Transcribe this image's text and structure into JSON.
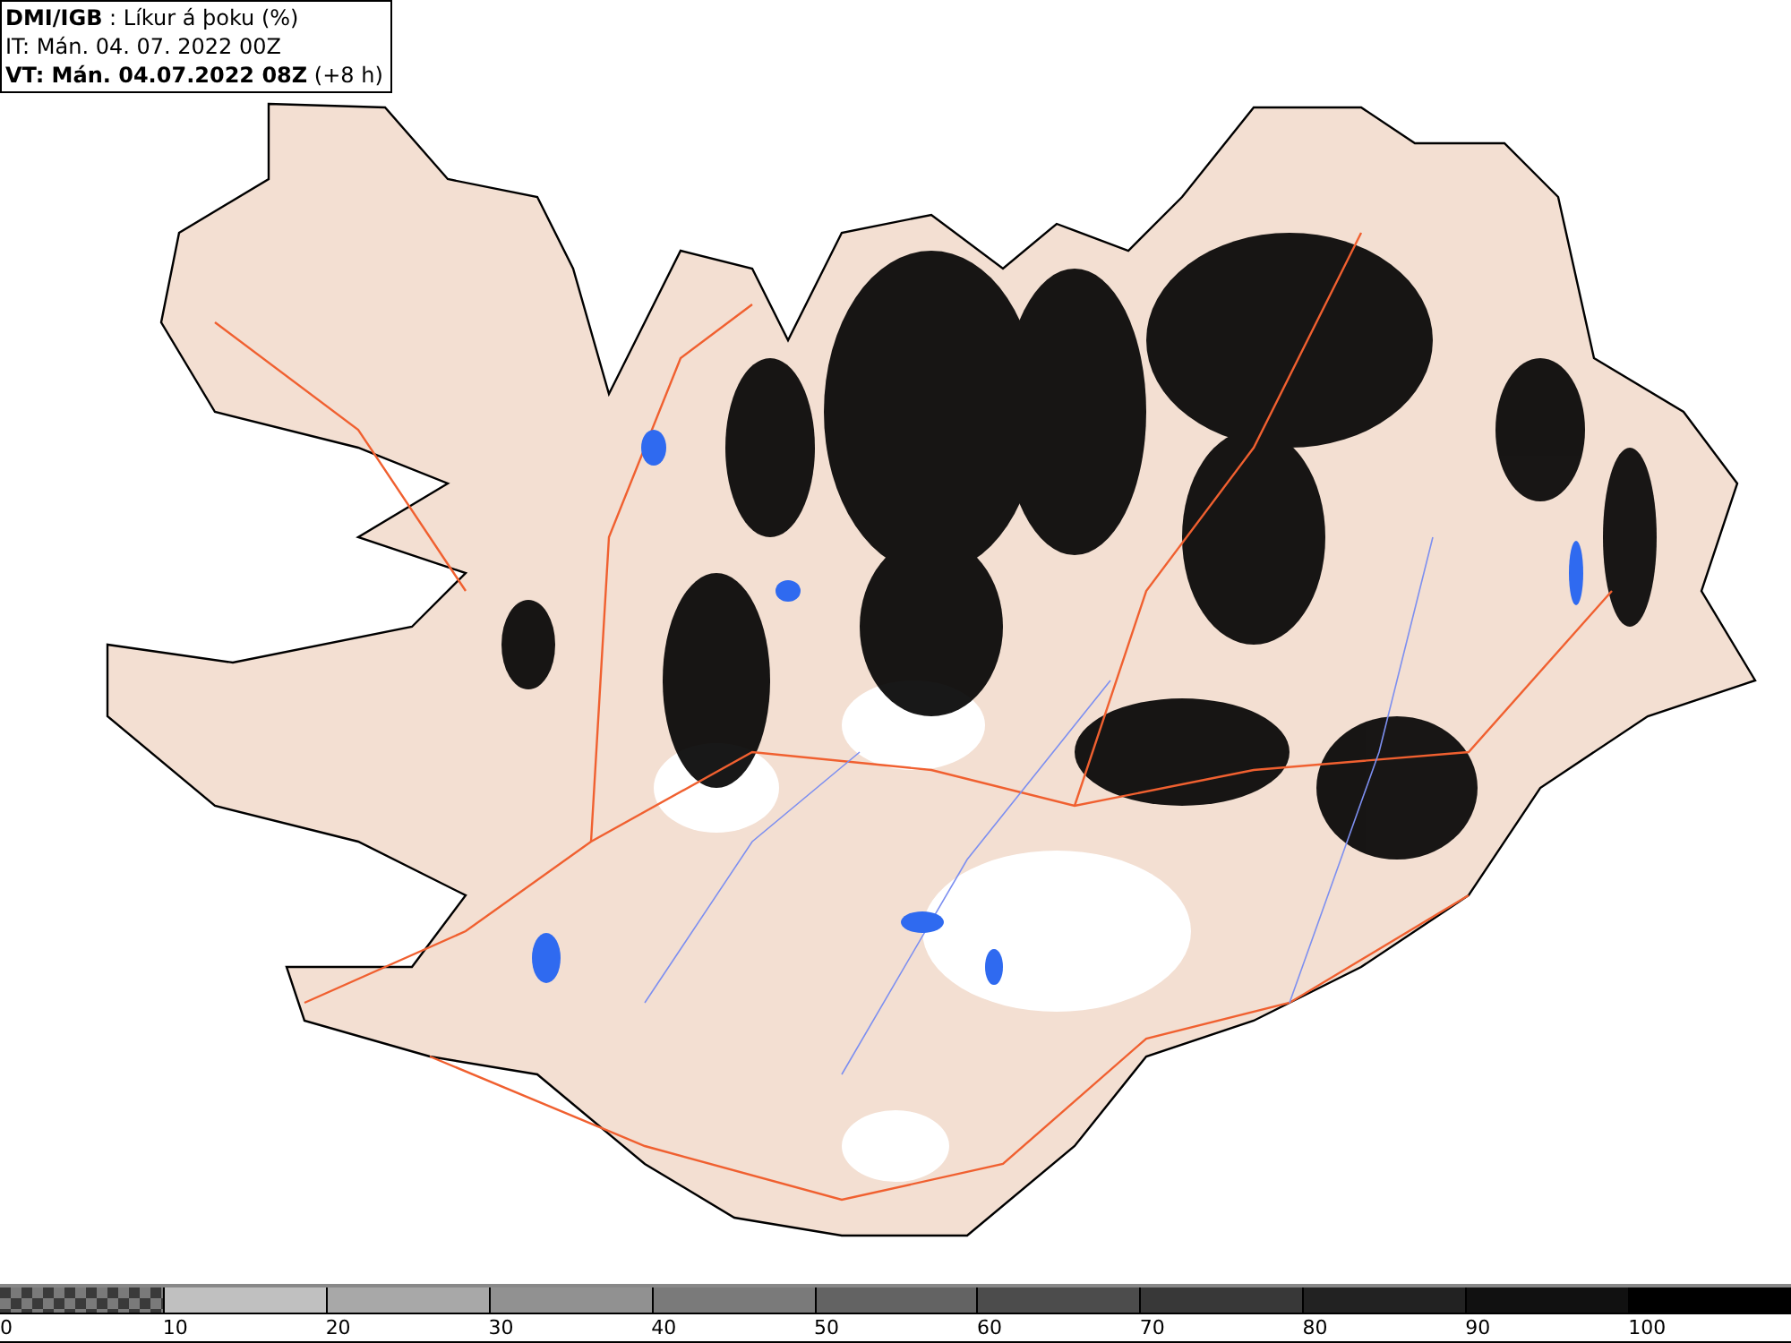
{
  "title_box": {
    "lines": [
      "**DMI/IGB** : Líkur á þoku (%)",
      "IT: Mán. 04. 07. 2022 00Z",
      "**VT: Mán. 04.07.2022 08Z** (+8 h)"
    ]
  },
  "legend": {
    "segments": [
      {
        "kind": "checker",
        "color": "#7a7a7a"
      },
      {
        "kind": "solid",
        "color": "#c0c0c0"
      },
      {
        "kind": "solid",
        "color": "#a8a8a8"
      },
      {
        "kind": "solid",
        "color": "#919191"
      },
      {
        "kind": "solid",
        "color": "#7a7a7a"
      },
      {
        "kind": "solid",
        "color": "#636363"
      },
      {
        "kind": "solid",
        "color": "#4c4c4c"
      },
      {
        "kind": "solid",
        "color": "#383838"
      },
      {
        "kind": "solid",
        "color": "#222222"
      },
      {
        "kind": "solid",
        "color": "#111111"
      },
      {
        "kind": "solid",
        "color": "#000000"
      }
    ],
    "ticks": [
      "0",
      "10",
      "20",
      "30",
      "40",
      "50",
      "60",
      "70",
      "80",
      "90",
      "100"
    ]
  }
}
